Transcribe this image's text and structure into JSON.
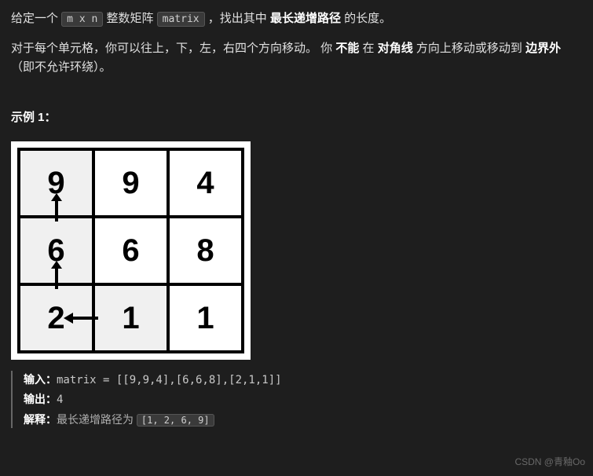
{
  "intro": {
    "pre1": "给定一个 ",
    "code1": "m x n",
    "mid1": " 整数矩阵 ",
    "code2": "matrix",
    "post1": " ，找出其中 ",
    "bold1": "最长递增路径",
    "post2": " 的长度。"
  },
  "para2": {
    "t1": "对于每个单元格，你可以往上，下，左，右四个方向移动。 你 ",
    "b1": "不能",
    "t2": " 在 ",
    "b2": "对角线",
    "t3": " 方向上移动或移动到 ",
    "b3": "边界外",
    "t4": "（即不允许环绕）。"
  },
  "example_heading": "示例 1：",
  "matrix": [
    [
      "9",
      "9",
      "4"
    ],
    [
      "6",
      "6",
      "8"
    ],
    [
      "2",
      "1",
      "1"
    ]
  ],
  "io": {
    "input_label": "输入：",
    "input_value": "matrix = [[9,9,4],[6,6,8],[2,1,1]]",
    "output_label": "输出：",
    "output_value": "4",
    "explain_label": "解释：",
    "explain_text": "最长递增路径为 ",
    "explain_code": "[1, 2, 6, 9]"
  },
  "watermark": "CSDN @青釉Oo",
  "chart_data": {
    "type": "table",
    "title": "3x3 integer matrix with longest increasing path highlighted",
    "rows": 3,
    "cols": 3,
    "values": [
      [
        9,
        9,
        4
      ],
      [
        6,
        6,
        8
      ],
      [
        2,
        1,
        1
      ]
    ],
    "highlighted_path_cells": [
      [
        2,
        1
      ],
      [
        2,
        0
      ],
      [
        1,
        0
      ],
      [
        0,
        0
      ]
    ],
    "path_values": [
      1,
      2,
      6,
      9
    ],
    "arrows": [
      {
        "from": [
          2,
          1
        ],
        "to": [
          2,
          0
        ],
        "dir": "left"
      },
      {
        "from": [
          2,
          0
        ],
        "to": [
          1,
          0
        ],
        "dir": "up"
      },
      {
        "from": [
          1,
          0
        ],
        "to": [
          0,
          0
        ],
        "dir": "up"
      }
    ]
  }
}
